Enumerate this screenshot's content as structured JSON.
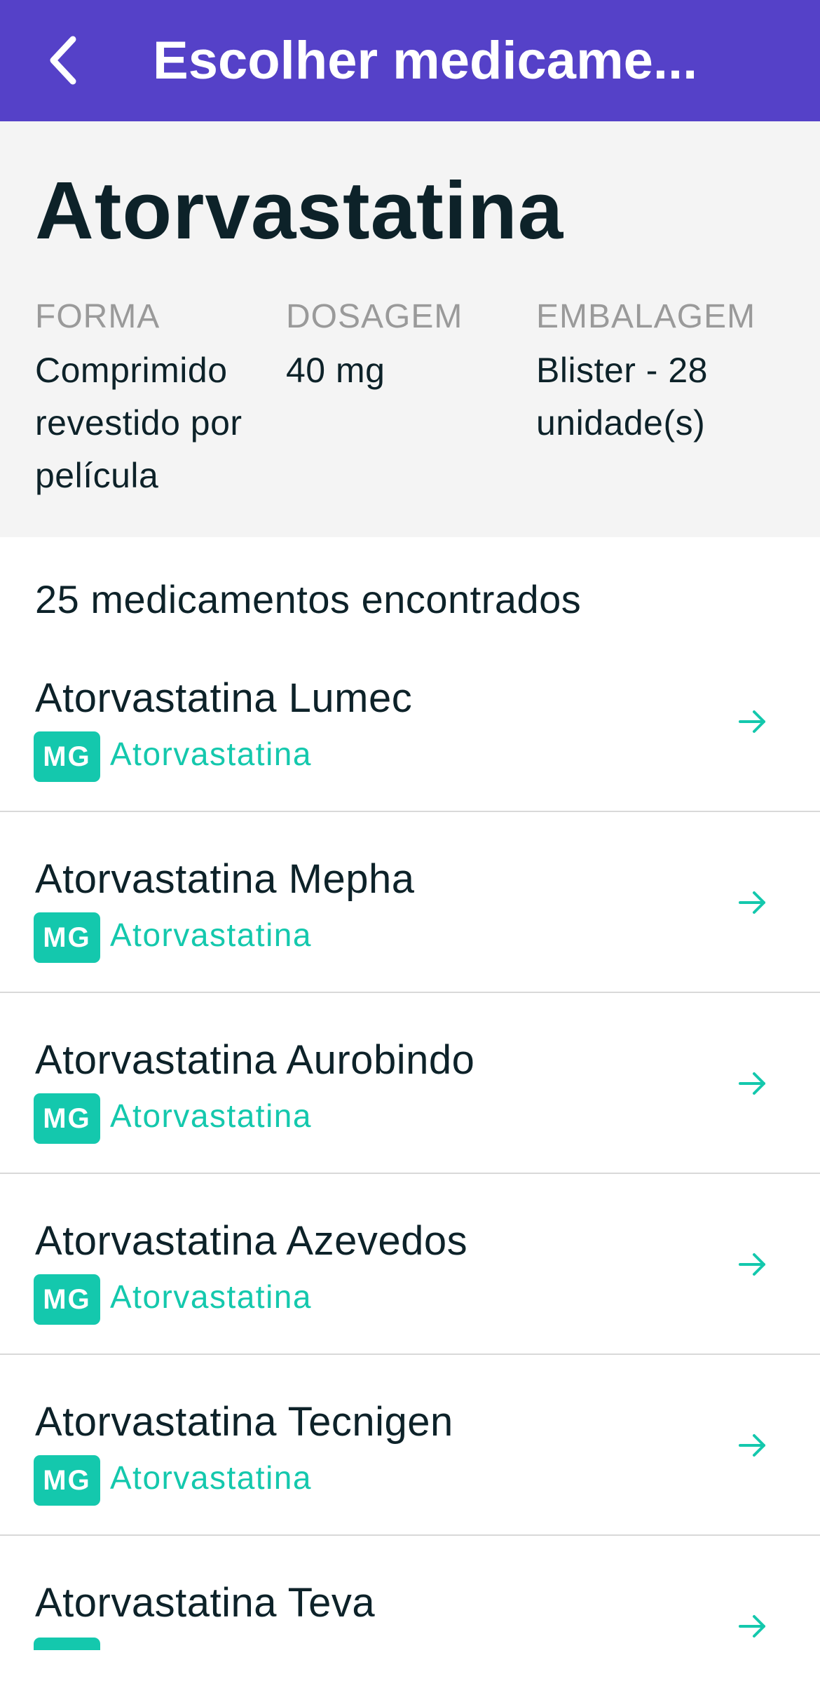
{
  "appbar": {
    "title": "Escolher medicame...",
    "back_icon": "chevron-left-icon",
    "background": "#5541c8"
  },
  "product": {
    "name": "Atorvastatina",
    "attributes": {
      "forma": {
        "label": "FORMA",
        "value": "Comprimido revestido por película"
      },
      "dosagem": {
        "label": "DOSAGEM",
        "value": "40 mg"
      },
      "embalagem": {
        "label": "EMBALAGEM",
        "value": "Blister - 28 unidade(s)"
      }
    }
  },
  "results": {
    "count_text": "25 medicamentos encontrados",
    "accent_color": "#14c8ad",
    "items": [
      {
        "name": "Atorvastatina Lumec",
        "badge": "MG",
        "generic": "Atorvastatina",
        "icon": "arrow-right-icon"
      },
      {
        "name": "Atorvastatina Mepha",
        "badge": "MG",
        "generic": "Atorvastatina",
        "icon": "arrow-right-icon"
      },
      {
        "name": "Atorvastatina Aurobindo",
        "badge": "MG",
        "generic": "Atorvastatina",
        "icon": "arrow-right-icon"
      },
      {
        "name": "Atorvastatina Azevedos",
        "badge": "MG",
        "generic": "Atorvastatina",
        "icon": "arrow-right-icon"
      },
      {
        "name": "Atorvastatina Tecnigen",
        "badge": "MG",
        "generic": "Atorvastatina",
        "icon": "arrow-right-icon"
      },
      {
        "name": "Atorvastatina Teva",
        "icon": "arrow-right-icon"
      }
    ]
  }
}
